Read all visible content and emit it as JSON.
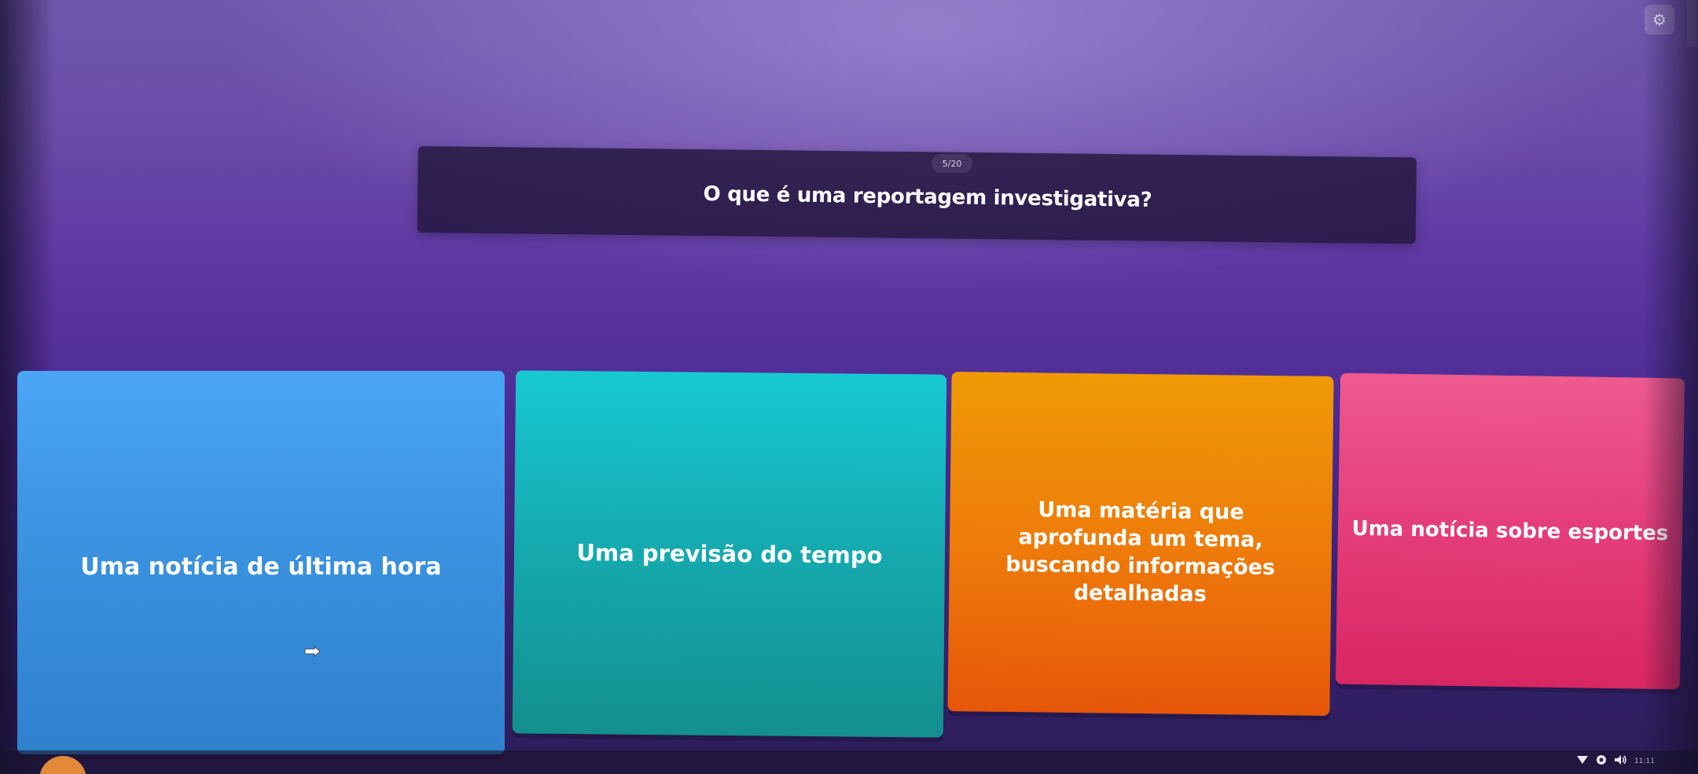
{
  "quiz": {
    "counter": "5/20",
    "question": "O que é uma reportagem investigativa?",
    "options": [
      {
        "label": "Uma notícia de última hora",
        "color": "#3a92e0"
      },
      {
        "label": "Uma previsão do tempo",
        "color": "#15a9ae"
      },
      {
        "label": "Uma matéria que aprofunda um tema, buscando informações detalhadas",
        "color": "#ee7c0a"
      },
      {
        "label": "Uma notícia sobre esportes",
        "color": "#e43d79"
      }
    ]
  },
  "toolbar": {
    "settings_icon": "gear-icon"
  },
  "system_tray": {
    "icons": [
      "wifi-icon",
      "network-icon",
      "volume-icon"
    ],
    "time": "11:11"
  },
  "theme": {
    "background_top": "#6f58ad",
    "background_bottom": "#2a1d57",
    "question_box": "#22163a"
  }
}
